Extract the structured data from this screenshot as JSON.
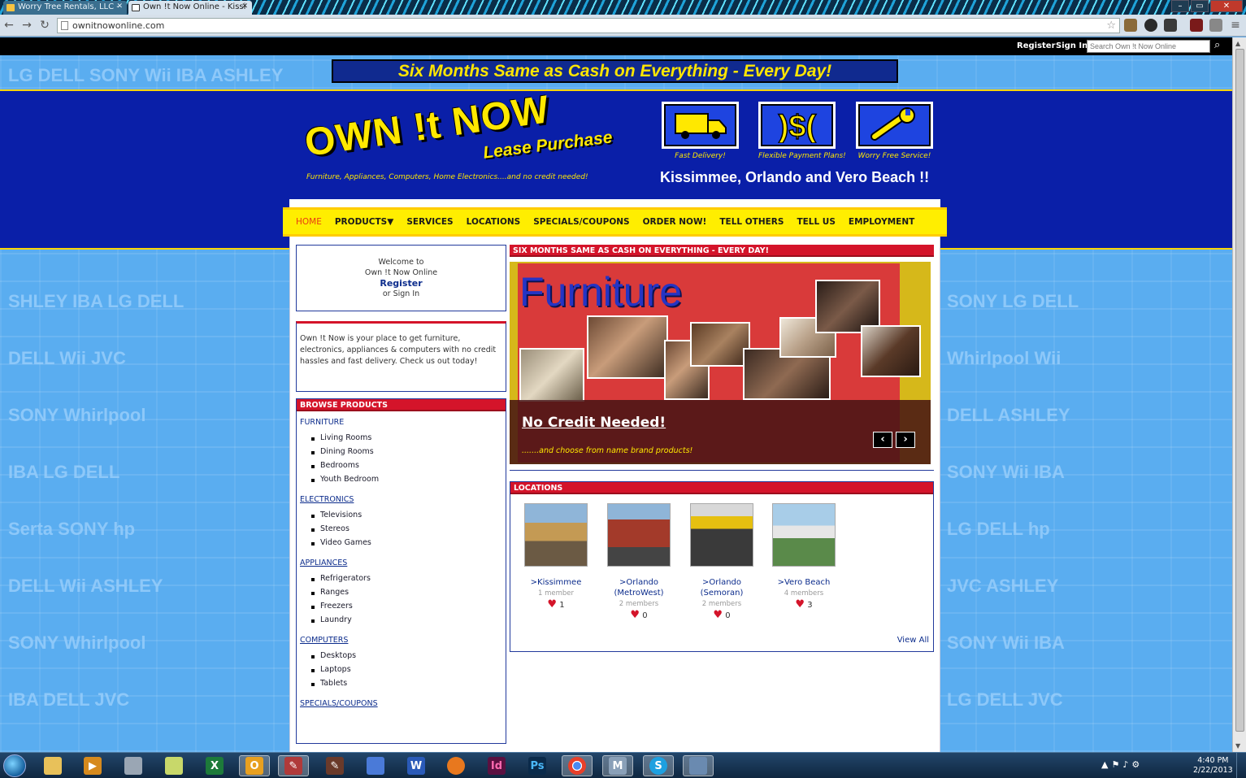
{
  "browser": {
    "tabs": [
      {
        "title": "Worry Tree Rentals, LLC -"
      },
      {
        "title": "Own !t Now Online - Kissi"
      }
    ],
    "url": "ownitnowonline.com"
  },
  "site_topbar": {
    "register": "Register",
    "sign_in": "Sign In",
    "search_placeholder": "Search Own !t Now Online"
  },
  "promo_banner": "Six Months Same as Cash on Everything - Every Day!",
  "header": {
    "logo_main": "OWN !t NOW",
    "logo_sub": "Lease Purchase",
    "tagline": "Furniture, Appliances, Computers, Home Electronics....and no credit needed!",
    "features": [
      {
        "label": "Fast Delivery!",
        "icon": "truck-icon"
      },
      {
        "label": "Flexible Payment Plans!",
        "icon": "dollar-icon"
      },
      {
        "label": "Worry Free Service!",
        "icon": "wrench-icon"
      }
    ],
    "cities": "Kissimmee, Orlando and Vero Beach !!"
  },
  "nav": {
    "items": [
      "HOME",
      "PRODUCTS▼",
      "SERVICES",
      "LOCATIONS",
      "SPECIALS/COUPONS",
      "ORDER NOW!",
      "TELL OTHERS",
      "TELL US",
      "EMPLOYMENT"
    ]
  },
  "welcome": {
    "line1": "Welcome to",
    "line2": "Own !t Now Online",
    "register": "Register",
    "or_sign_in": "or Sign In"
  },
  "about_text": "Own !t Now is your place to get furniture, electronics, appliances & computers with no credit hassles and fast delivery. Check us out today!",
  "browse": {
    "title": "BROWSE PRODUCTS",
    "furniture": {
      "label": "FURNITURE",
      "items": [
        "Living Rooms",
        "Dining Rooms",
        "Bedrooms",
        "Youth Bedroom"
      ]
    },
    "electronics": {
      "label": "ELECTRONICS",
      "items": [
        "Televisions",
        "Stereos",
        "Video Games"
      ]
    },
    "appliances": {
      "label": "APPLIANCES",
      "items": [
        "Refrigerators",
        "Ranges",
        "Freezers",
        "Laundry"
      ]
    },
    "computers": {
      "label": "COMPUTERS",
      "items": [
        "Desktops",
        "Laptops",
        "Tablets"
      ]
    },
    "specials": {
      "label": "SPECIALS/COUPONS"
    }
  },
  "slider": {
    "title": "SIX MONTHS SAME AS CASH ON EVERYTHING - EVERY DAY!",
    "slide_heading": "Furniture",
    "caption_title": "No Credit Needed!",
    "caption_sub": ".......and choose from name brand products!",
    "prev": "‹",
    "next": "›"
  },
  "locations": {
    "title": "LOCATIONS",
    "items": [
      {
        "name": ">Kissimmee",
        "members": "1 member",
        "likes": "1"
      },
      {
        "name": ">Orlando (MetroWest)",
        "members": "2 members",
        "likes": "0"
      },
      {
        "name": ">Orlando (Semoran)",
        "members": "2 members",
        "likes": "0"
      },
      {
        "name": ">Vero Beach",
        "members": "4 members",
        "likes": "3"
      }
    ],
    "view_all": "View All"
  },
  "taskbar": {
    "clock_time": "4:40 PM",
    "clock_date": "2/22/2013",
    "apps": [
      "folder",
      "media",
      "calculator",
      "files",
      "excel",
      "outlook",
      "paint",
      "pen",
      "network",
      "word",
      "fruit",
      "indesign",
      "photoshop",
      "chrome",
      "mail",
      "skype",
      "window"
    ]
  },
  "colors": {
    "header_blue": "#0a1fa8",
    "accent_yellow": "#ffee00",
    "panel_red": "#d4142a",
    "link_blue": "#0c2c8c"
  }
}
